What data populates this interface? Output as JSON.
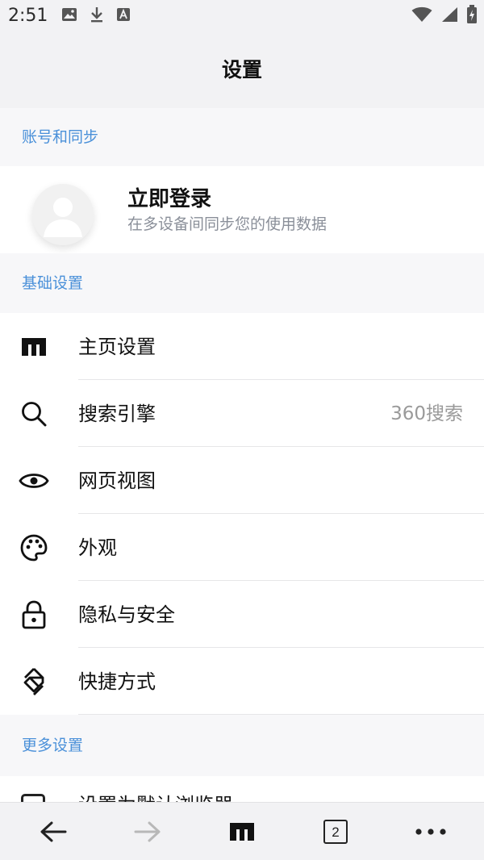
{
  "status_bar": {
    "time": "2:51",
    "icons": [
      "image-icon",
      "download-icon",
      "keyboard-a-icon",
      "wifi-icon",
      "signal-icon",
      "battery-icon"
    ]
  },
  "header": {
    "title": "设置"
  },
  "sections": {
    "account": "账号和同步",
    "basic": "基础设置",
    "more": "更多设置"
  },
  "account": {
    "login_title": "立即登录",
    "login_subtitle": "在多设备间同步您的使用数据"
  },
  "settings_items": [
    {
      "label": "主页设置",
      "icon": "home-icon",
      "value": ""
    },
    {
      "label": "搜索引擎",
      "icon": "search-icon",
      "value": "360搜索"
    },
    {
      "label": "网页视图",
      "icon": "eye-icon",
      "value": ""
    },
    {
      "label": "外观",
      "icon": "palette-icon",
      "value": ""
    },
    {
      "label": "隐私与安全",
      "icon": "lock-icon",
      "value": ""
    },
    {
      "label": "快捷方式",
      "icon": "shortcut-icon",
      "value": ""
    }
  ],
  "more_partial": {
    "label": "设置为默认浏览器"
  },
  "bottom_nav": {
    "tab_count": "2",
    "buttons": [
      "back-arrow-icon",
      "forward-arrow-icon",
      "home-icon",
      "tabs-icon",
      "more-icon"
    ]
  },
  "colors": {
    "accent": "#4a90d9",
    "chrome_bg": "#f2f2f4",
    "section_bg": "#f7f7f9",
    "secondary_text": "#8a8f99",
    "disabled": "#b8b8b8"
  }
}
